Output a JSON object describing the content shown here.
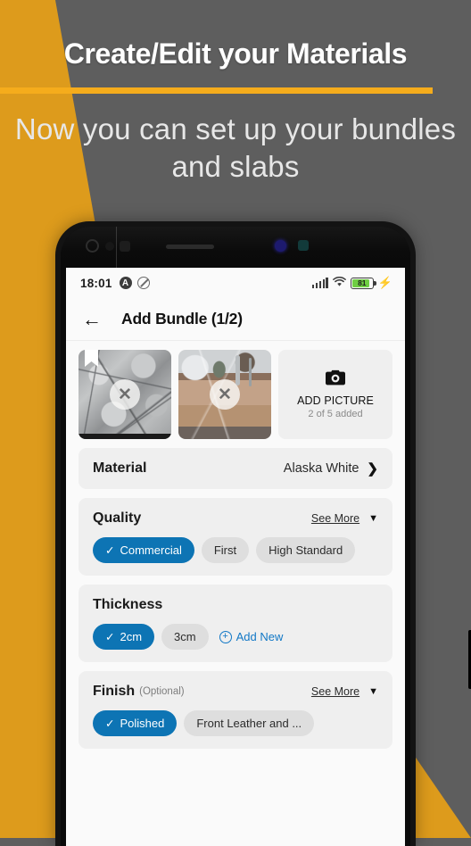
{
  "promo": {
    "title": "Create/Edit your Materials",
    "subtitle": "Now you can set up your bundles and slabs",
    "accent_color": "#f5ac1c",
    "background_color": "#5e5e5e",
    "yellow_color": "#dd9b1c"
  },
  "status_bar": {
    "time": "18:01",
    "app_icon": "A",
    "mute_icon": "mute-icon",
    "signal_icon": "signal-bars-icon",
    "wifi_icon": "wifi-icon",
    "battery_level": "81",
    "battery_color": "#6fce43",
    "charging_icon": "⚡"
  },
  "appbar": {
    "back_icon": "←",
    "title": "Add Bundle (1/2)"
  },
  "photos": {
    "thumbnails": [
      {
        "alt": "granite-slab-gray",
        "primary": true,
        "remove_icon": "✕"
      },
      {
        "alt": "countertop-install",
        "primary": false,
        "remove_icon": "✕"
      }
    ],
    "add_picture": {
      "icon": "📷",
      "label": "ADD PICTURE",
      "count_text": "2 of 5 added"
    }
  },
  "material": {
    "label": "Material",
    "value": "Alaska White",
    "chevron": "❯"
  },
  "quality": {
    "label": "Quality",
    "see_more": "See More",
    "caret": "▼",
    "options": [
      {
        "label": "Commercial",
        "selected": true
      },
      {
        "label": "First",
        "selected": false
      },
      {
        "label": "High Standard",
        "selected": false
      }
    ]
  },
  "thickness": {
    "label": "Thickness",
    "options": [
      {
        "label": "2cm",
        "selected": true
      },
      {
        "label": "3cm",
        "selected": false
      }
    ],
    "add_new": "Add New",
    "add_new_icon": "+"
  },
  "finish": {
    "label": "Finish",
    "optional": "(Optional)",
    "see_more": "See More",
    "caret": "▼",
    "options": [
      {
        "label": "Polished",
        "selected": true
      },
      {
        "label": "Front Leather and ...",
        "selected": false
      }
    ]
  },
  "theme": {
    "accent_blue": "#0d74b4",
    "link_blue": "#1278c6",
    "card_bg": "#efefef",
    "chip_bg": "#dedede",
    "check_glyph": "✓"
  }
}
